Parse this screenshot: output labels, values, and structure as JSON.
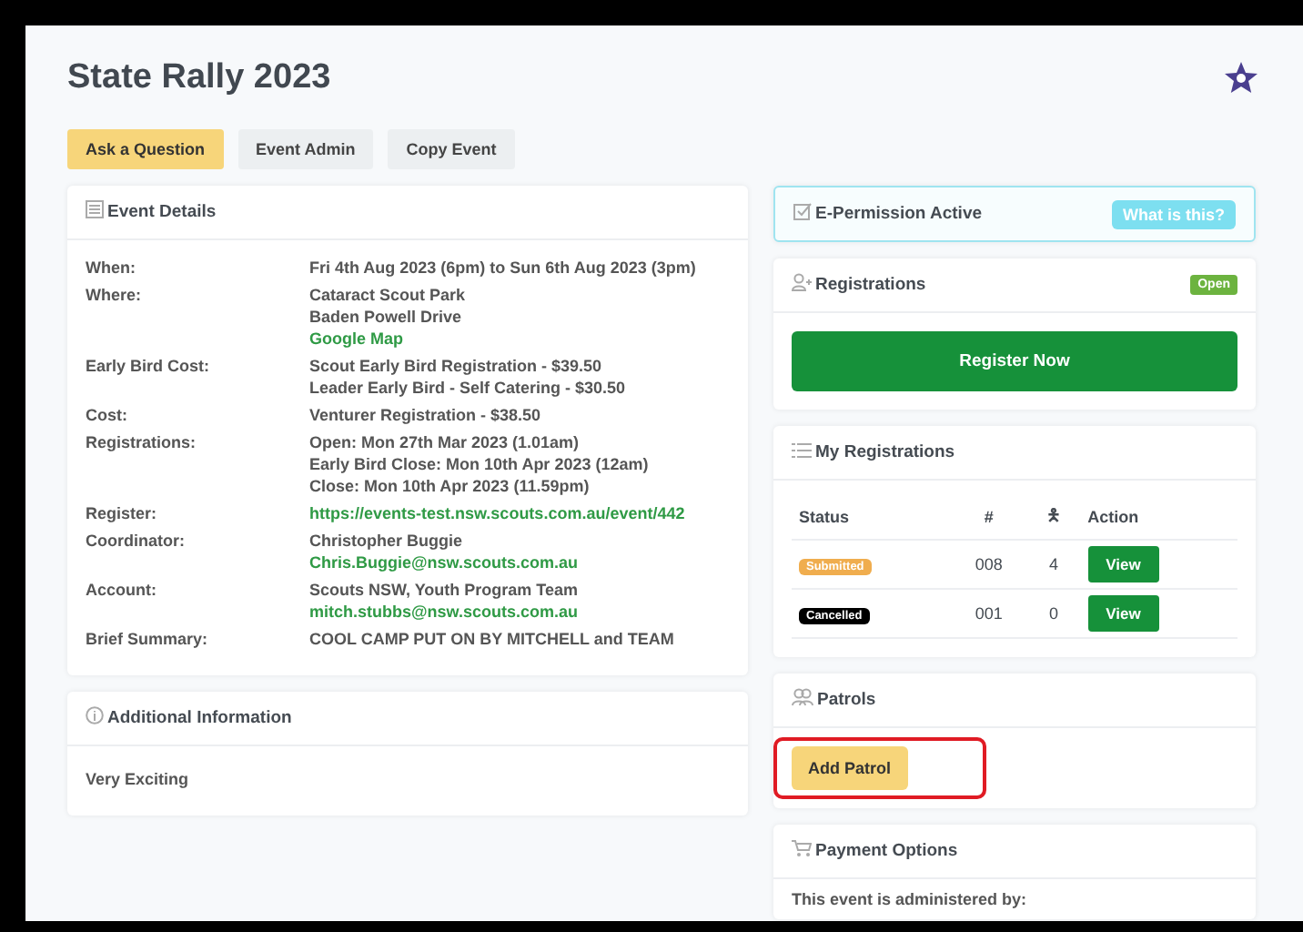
{
  "title": "State Rally 2023",
  "actions": [
    {
      "label": "Ask a Question",
      "kind": "primary"
    },
    {
      "label": "Event Admin",
      "kind": "secondary"
    },
    {
      "label": "Copy Event",
      "kind": "secondary"
    }
  ],
  "event_details": {
    "title": "Event Details",
    "rows": [
      {
        "label": "When:",
        "lines": [
          {
            "text": "Fri 4th Aug 2023 (6pm) to Sun 6th Aug 2023 (3pm)",
            "kind": "text"
          }
        ]
      },
      {
        "label": "Where:",
        "lines": [
          {
            "text": "Cataract Scout Park",
            "kind": "text"
          },
          {
            "text": "Baden Powell Drive",
            "kind": "text"
          },
          {
            "text": "Google Map",
            "kind": "link"
          }
        ]
      },
      {
        "label": "Early Bird Cost:",
        "lines": [
          {
            "text": "Scout Early Bird Registration - $39.50",
            "kind": "text"
          },
          {
            "text": "Leader Early Bird - Self Catering - $30.50",
            "kind": "text"
          }
        ]
      },
      {
        "label": "Cost:",
        "lines": [
          {
            "text": "Venturer Registration - $38.50",
            "kind": "text"
          }
        ]
      },
      {
        "label": "Registrations:",
        "lines": [
          {
            "text": "Open: Mon 27th Mar 2023 (1.01am)",
            "kind": "text"
          },
          {
            "text": "Early Bird Close: Mon 10th Apr 2023 (12am)",
            "kind": "text"
          },
          {
            "text": "Close: Mon 10th Apr 2023 (11.59pm)",
            "kind": "text"
          }
        ]
      },
      {
        "label": "Register:",
        "lines": [
          {
            "text": "https://events-test.nsw.scouts.com.au/event/442",
            "kind": "link"
          }
        ]
      },
      {
        "label": "Coordinator:",
        "lines": [
          {
            "text": "Christopher Buggie",
            "kind": "text"
          },
          {
            "text": "Chris.Buggie@nsw.scouts.com.au",
            "kind": "link"
          }
        ]
      },
      {
        "label": "Account:",
        "lines": [
          {
            "text": "Scouts NSW, Youth Program Team",
            "kind": "text"
          },
          {
            "text": "mitch.stubbs@nsw.scouts.com.au",
            "kind": "link"
          }
        ]
      },
      {
        "label": "Brief Summary:",
        "lines": [
          {
            "text": "COOL CAMP PUT ON BY MITCHELL and TEAM",
            "kind": "text"
          }
        ]
      }
    ]
  },
  "additional_information": {
    "title": "Additional Information",
    "text": "Very Exciting"
  },
  "e_permission": {
    "title": "E-Permission Active",
    "help_button": "What is this?"
  },
  "registrations": {
    "title": "Registrations",
    "badge": "Open",
    "button": "Register Now"
  },
  "my_registrations": {
    "title": "My Registrations",
    "columns": [
      "Status",
      "#",
      "🯅",
      "Action"
    ],
    "rows": [
      {
        "status": "Submitted",
        "color": "#f0ad4e",
        "number": "008",
        "count": "4",
        "action": "View"
      },
      {
        "status": "Cancelled",
        "color": "#000000",
        "number": "001",
        "count": "0",
        "action": "View"
      }
    ]
  },
  "patrols": {
    "title": "Patrols",
    "button": {
      "label": "Add Patrol",
      "highlighted": true
    }
  },
  "payment_options": {
    "title": "Payment Options",
    "text": "This event is administered by:"
  }
}
